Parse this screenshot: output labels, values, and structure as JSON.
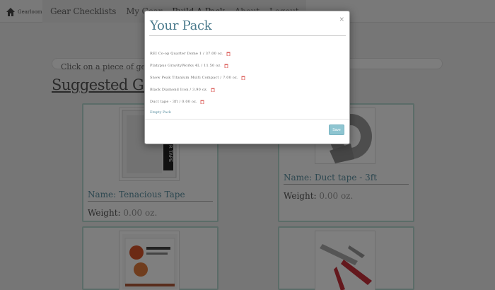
{
  "navbar": {
    "brand": "Gearloom",
    "links": [
      "Gear Checklists",
      "My Gear",
      "Build A Pack",
      "About",
      "Logout"
    ]
  },
  "page": {
    "info_text": "Click on a piece of gear to ad",
    "section_title": "Suggested Gear",
    "cards": [
      {
        "name": "Name: Tenacious Tape",
        "weight_label": "Weight:",
        "weight_value": "0.00 oz.",
        "image": "tenacious-tape"
      },
      {
        "name": "Name: Duct tape - 3ft",
        "weight_label": "Weight:",
        "weight_value": "0.00 oz.",
        "image": "duct-tape"
      },
      {
        "name": "",
        "weight_label": "",
        "weight_value": "",
        "image": "tenacious-splint"
      },
      {
        "name": "",
        "weight_label": "",
        "weight_value": "",
        "image": "multitool"
      }
    ]
  },
  "modal": {
    "title": "Your Pack",
    "close": "×",
    "items": [
      "REI Co-op Quarter Dome 1 / 37.00 oz.",
      "Platypus GravityWorks 4L / 11.50 oz.",
      "Snow Peak Titanium Multi Compact / 7.00 oz.",
      "Black Diamond Icon / 3.90 oz.",
      "Duct tape - 3ft / 0.00 oz."
    ],
    "empty_label": "Empty Pack",
    "save_label": "Save"
  },
  "colors": {
    "accent": "#5a8fa0",
    "card_border": "#b7d8d1",
    "save_button": "#8ec5d1",
    "trash": "#d9534f"
  }
}
